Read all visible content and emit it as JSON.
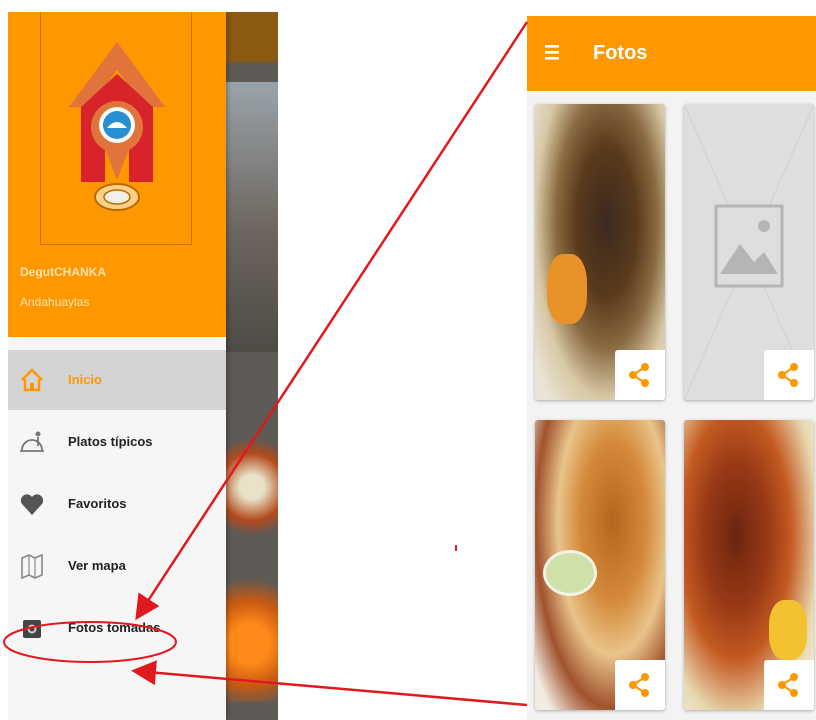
{
  "drawer": {
    "app_name": "DegutCHANKA",
    "app_city": "Andahuaylas",
    "items": [
      {
        "label": "Inicio",
        "icon": "home-icon",
        "active": true
      },
      {
        "label": "Platos típicos",
        "icon": "dish-icon",
        "active": false
      },
      {
        "label": "Favoritos",
        "icon": "heart-icon",
        "active": false
      },
      {
        "label": "Ver mapa",
        "icon": "map-icon",
        "active": false
      },
      {
        "label": "Fotos tomadas",
        "icon": "camera-icon",
        "active": false
      }
    ]
  },
  "photos_screen": {
    "title": "Fotos",
    "menu_icon": "hamburger-menu-icon",
    "share_icon": "share-icon",
    "photos": [
      {
        "content": "food-photo"
      },
      {
        "content": "image-placeholder-icon"
      },
      {
        "content": "food-photo"
      },
      {
        "content": "food-photo"
      }
    ]
  },
  "colors": {
    "primary": "#ff9800",
    "annotation": "#e0191f",
    "active_item_bg": "#d4d4d4"
  }
}
